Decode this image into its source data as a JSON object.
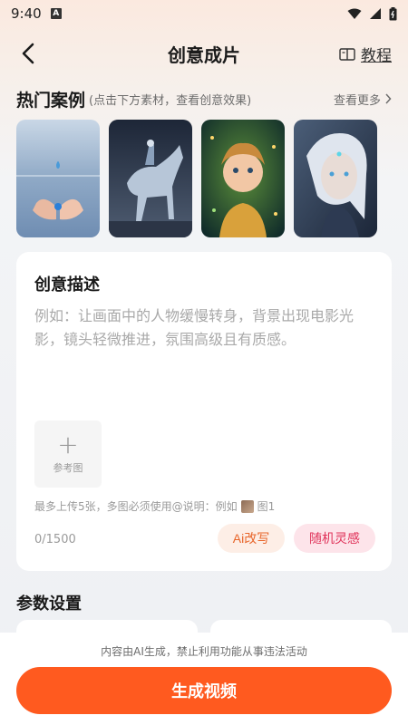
{
  "status_bar": {
    "time": "9:40",
    "badge": "A"
  },
  "header": {
    "title": "创意成片",
    "tutorial_label": "教程"
  },
  "hot_cases": {
    "title": "热门案例",
    "subtitle": "(点击下方素材，查看创意效果)",
    "see_more": "查看更多"
  },
  "description": {
    "title": "创意描述",
    "placeholder": "例如：让画面中的人物缓慢转身，背景出现电影光影，镜头轻微推进，氛围高级且有质感。",
    "upload_label": "参考图",
    "hint_prefix": "最多上传5张，多图必须使用@说明：例如",
    "hint_suffix": "图1",
    "counter": "0/1500",
    "ai_rewrite": "Ai改写",
    "random_idea": "随机灵感"
  },
  "params": {
    "title": "参数设置"
  },
  "footer": {
    "disclaimer": "内容由AI生成，禁止利用功能从事违法活动",
    "generate_label": "生成视频"
  },
  "colors": {
    "accent": "#ff5a1f",
    "ai_text": "#e8652a",
    "random_text": "#e0335a"
  }
}
